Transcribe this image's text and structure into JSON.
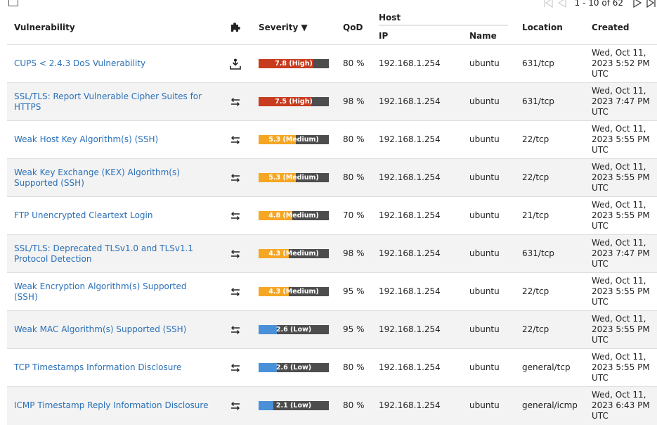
{
  "pagination": {
    "range": "1 - 10 of 62"
  },
  "columns": {
    "vulnerability": "Vulnerability",
    "severity": "Severity ▼",
    "qod": "QoD",
    "host": "Host",
    "ip": "IP",
    "name": "Name",
    "location": "Location",
    "created": "Created"
  },
  "colors": {
    "high": "#c83b1f",
    "medium": "#f5a623",
    "low": "#4a90d9",
    "bar_bg": "#4d4d4d",
    "link": "#2a70b8"
  },
  "rows": [
    {
      "vulnerability": "CUPS < 2.4.3 DoS Vulnerability",
      "solution_icon": "vendorfix-icon",
      "severity_value": 7.8,
      "severity": "7.8 (High)",
      "level": "high",
      "qod": "80 %",
      "ip": "192.168.1.254",
      "name": "ubuntu",
      "location": "631/tcp",
      "created": "Wed, Oct 11, 2023 5:52 PM UTC"
    },
    {
      "vulnerability": "SSL/TLS: Report Vulnerable Cipher Suites for HTTPS",
      "solution_icon": "mitigation-icon",
      "severity_value": 7.5,
      "severity": "7.5 (High)",
      "level": "high",
      "qod": "98 %",
      "ip": "192.168.1.254",
      "name": "ubuntu",
      "location": "631/tcp",
      "created": "Wed, Oct 11, 2023 7:47 PM UTC"
    },
    {
      "vulnerability": "Weak Host Key Algorithm(s) (SSH)",
      "solution_icon": "mitigation-icon",
      "severity_value": 5.3,
      "severity": "5.3 (Medium)",
      "level": "medium",
      "qod": "80 %",
      "ip": "192.168.1.254",
      "name": "ubuntu",
      "location": "22/tcp",
      "created": "Wed, Oct 11, 2023 5:55 PM UTC"
    },
    {
      "vulnerability": "Weak Key Exchange (KEX) Algorithm(s) Supported (SSH)",
      "solution_icon": "mitigation-icon",
      "severity_value": 5.3,
      "severity": "5.3 (Medium)",
      "level": "medium",
      "qod": "80 %",
      "ip": "192.168.1.254",
      "name": "ubuntu",
      "location": "22/tcp",
      "created": "Wed, Oct 11, 2023 5:55 PM UTC"
    },
    {
      "vulnerability": "FTP Unencrypted Cleartext Login",
      "solution_icon": "mitigation-icon",
      "severity_value": 4.8,
      "severity": "4.8 (Medium)",
      "level": "medium",
      "qod": "70 %",
      "ip": "192.168.1.254",
      "name": "ubuntu",
      "location": "21/tcp",
      "created": "Wed, Oct 11, 2023 5:55 PM UTC"
    },
    {
      "vulnerability": "SSL/TLS: Deprecated TLSv1.0 and TLSv1.1 Protocol Detection",
      "solution_icon": "mitigation-icon",
      "severity_value": 4.3,
      "severity": "4.3 (Medium)",
      "level": "medium",
      "qod": "98 %",
      "ip": "192.168.1.254",
      "name": "ubuntu",
      "location": "631/tcp",
      "created": "Wed, Oct 11, 2023 7:47 PM UTC"
    },
    {
      "vulnerability": "Weak Encryption Algorithm(s) Supported (SSH)",
      "solution_icon": "mitigation-icon",
      "severity_value": 4.3,
      "severity": "4.3 (Medium)",
      "level": "medium",
      "qod": "95 %",
      "ip": "192.168.1.254",
      "name": "ubuntu",
      "location": "22/tcp",
      "created": "Wed, Oct 11, 2023 5:55 PM UTC"
    },
    {
      "vulnerability": "Weak MAC Algorithm(s) Supported (SSH)",
      "solution_icon": "mitigation-icon",
      "severity_value": 2.6,
      "severity": "2.6 (Low)",
      "level": "low",
      "qod": "95 %",
      "ip": "192.168.1.254",
      "name": "ubuntu",
      "location": "22/tcp",
      "created": "Wed, Oct 11, 2023 5:55 PM UTC"
    },
    {
      "vulnerability": "TCP Timestamps Information Disclosure",
      "solution_icon": "mitigation-icon",
      "severity_value": 2.6,
      "severity": "2.6 (Low)",
      "level": "low",
      "qod": "80 %",
      "ip": "192.168.1.254",
      "name": "ubuntu",
      "location": "general/tcp",
      "created": "Wed, Oct 11, 2023 5:55 PM UTC"
    },
    {
      "vulnerability": "ICMP Timestamp Reply Information Disclosure",
      "solution_icon": "mitigation-icon",
      "severity_value": 2.1,
      "severity": "2.1 (Low)",
      "level": "low",
      "qod": "80 %",
      "ip": "192.168.1.254",
      "name": "ubuntu",
      "location": "general/icmp",
      "created": "Wed, Oct 11, 2023 6:43 PM UTC"
    }
  ]
}
